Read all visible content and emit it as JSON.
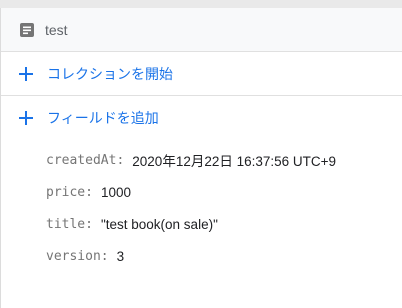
{
  "document": {
    "title": "test",
    "icon": "document-icon"
  },
  "actions": {
    "start_collection": "コレクションを開始",
    "add_field": "フィールドを追加",
    "icon": "plus-icon",
    "accent_color": "#1a73e8"
  },
  "fields": [
    {
      "key": "createdAt:",
      "value": "2020年12月22日 16:37:56 UTC+9"
    },
    {
      "key": "price:",
      "value": "1000"
    },
    {
      "key": "title:",
      "value": "\"test book(on sale)\""
    },
    {
      "key": "version:",
      "value": "3"
    }
  ]
}
